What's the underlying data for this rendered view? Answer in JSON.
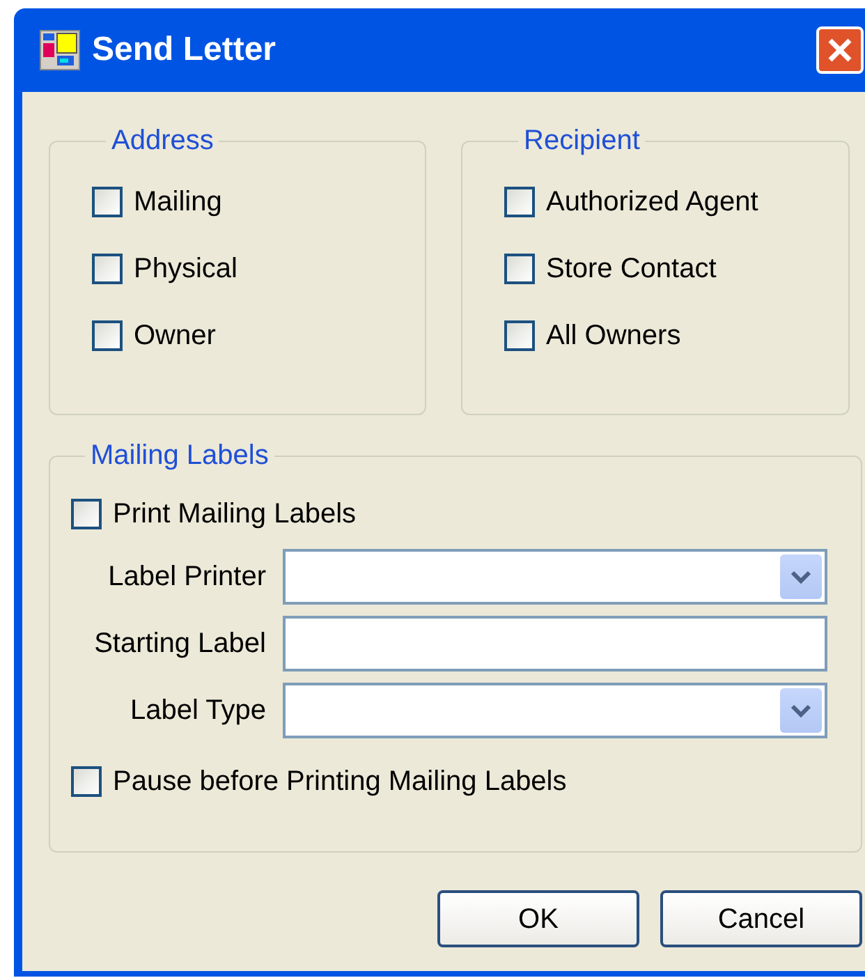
{
  "window": {
    "title": "Send Letter"
  },
  "address": {
    "title": "Address",
    "options": [
      {
        "label": "Mailing",
        "checked": false
      },
      {
        "label": "Physical",
        "checked": false
      },
      {
        "label": "Owner",
        "checked": false
      }
    ]
  },
  "recipient": {
    "title": "Recipient",
    "options": [
      {
        "label": "Authorized Agent",
        "checked": false
      },
      {
        "label": "Store Contact",
        "checked": false
      },
      {
        "label": "All Owners",
        "checked": false
      }
    ]
  },
  "mailing_labels": {
    "title": "Mailing Labels",
    "print": {
      "label": "Print Mailing Labels",
      "checked": false
    },
    "fields": [
      {
        "label": "Label Printer",
        "kind": "combobox"
      },
      {
        "label": "Starting Label",
        "kind": "textbox"
      },
      {
        "label": "Label Type",
        "kind": "combobox"
      }
    ],
    "pause": {
      "label": "Pause before Printing Mailing Labels",
      "checked": false
    }
  },
  "buttons": [
    "OK",
    "Cancel"
  ]
}
